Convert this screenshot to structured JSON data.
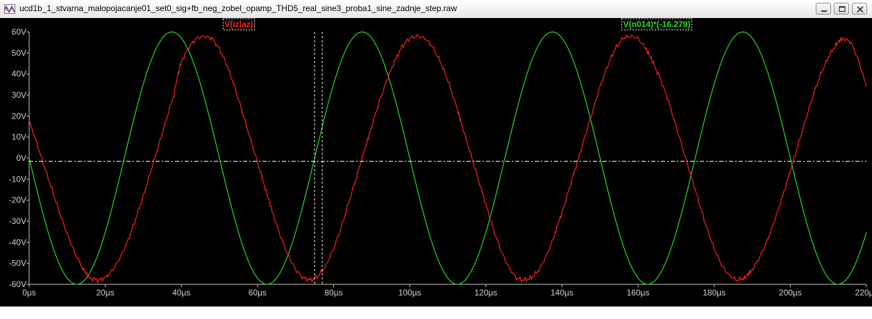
{
  "window": {
    "title": "ucd1b_1_stvarna_malopojacanje01_set0_sig+fb_neg_zobel_opamp_THD5_real_sine3_proba1_sine_zadnje_step.raw",
    "app_icon": "waveform-icon",
    "controls": [
      "minimize-icon",
      "maximize-icon",
      "close-icon"
    ]
  },
  "colors": {
    "background": "#000000",
    "axis": "#c8c8c8",
    "trace_red": "#ff2020",
    "trace_green": "#20e020",
    "cursor": "#ffffff"
  },
  "chart_data": {
    "type": "line",
    "title": "",
    "xlabel": "",
    "ylabel": "",
    "xlim": [
      0,
      220
    ],
    "ylim": [
      -60,
      60
    ],
    "x_unit": "µs",
    "y_unit": "V",
    "x_ticks": [
      "0µs",
      "20µs",
      "40µs",
      "60µs",
      "80µs",
      "100µs",
      "120µs",
      "140µs",
      "160µs",
      "180µs",
      "200µs",
      "220µs"
    ],
    "y_ticks": [
      "60V",
      "50V",
      "40V",
      "30V",
      "20V",
      "10V",
      "0V",
      "-10V",
      "-20V",
      "-30V",
      "-40V",
      "-50V",
      "-60V"
    ],
    "series": [
      {
        "name": "V(izlaz)",
        "color": "#ff2020",
        "x": [
          0,
          2,
          4,
          6,
          8,
          10,
          12,
          14,
          15,
          16,
          18,
          20,
          22,
          24,
          26,
          28,
          30,
          32,
          34,
          36,
          38,
          39,
          40,
          42,
          44,
          46,
          48,
          50,
          52,
          54,
          56,
          58,
          60,
          62,
          63,
          64,
          66,
          68,
          70,
          72,
          74,
          76,
          78,
          80,
          82,
          84,
          86,
          88,
          89,
          90,
          92,
          94,
          96,
          98,
          100,
          102,
          104,
          106,
          108,
          110,
          112,
          113,
          114,
          116,
          118,
          120,
          122,
          124,
          126,
          128,
          130,
          132,
          134,
          136,
          138,
          139,
          140,
          142,
          144,
          146,
          148,
          150,
          152,
          154,
          156,
          158,
          160,
          162,
          163,
          164,
          166,
          168,
          170,
          172,
          174,
          176,
          178,
          180,
          182,
          184,
          186,
          188,
          189,
          190,
          192,
          194,
          196,
          198,
          200,
          202,
          204,
          206,
          208,
          210,
          212,
          213,
          214,
          216,
          218,
          220
        ],
        "y": [
          18,
          7,
          -4,
          -15,
          -26,
          -36,
          -45,
          -52,
          -55,
          -57,
          -58,
          -57,
          -53,
          -47,
          -39,
          -29,
          -18,
          -6,
          6,
          18,
          30,
          39,
          46,
          53,
          57,
          58,
          57,
          52,
          44,
          34,
          22,
          10,
          -2,
          -14,
          -20,
          -26,
          -37,
          -46,
          -53,
          -57,
          -58,
          -56,
          -51,
          -43,
          -33,
          -21,
          -9,
          3,
          9,
          15,
          27,
          37,
          46,
          53,
          57,
          58,
          57,
          53,
          46,
          37,
          26,
          20,
          14,
          2,
          -10,
          -22,
          -34,
          -44,
          -52,
          -57,
          -58,
          -57,
          -53,
          -46,
          -37,
          -31,
          -26,
          -14,
          -2,
          10,
          22,
          34,
          44,
          52,
          57,
          58,
          57,
          52,
          49,
          45,
          37,
          27,
          15,
          3,
          -9,
          -21,
          -33,
          -43,
          -51,
          -56,
          -58,
          -57,
          -55,
          -53,
          -47,
          -39,
          -29,
          -18,
          -6,
          6,
          18,
          30,
          40,
          48,
          54,
          56,
          57,
          55,
          46,
          34
        ]
      },
      {
        "name": "V(n014)*(-16.279)",
        "color": "#20e020",
        "function": "-60*sin(2*pi*x/50)",
        "period": 50,
        "amplitude": 60
      }
    ],
    "cursor_lines_x": [
      75,
      77
    ],
    "cursor_line_y": -1.5,
    "grid": false,
    "legend": "top"
  }
}
